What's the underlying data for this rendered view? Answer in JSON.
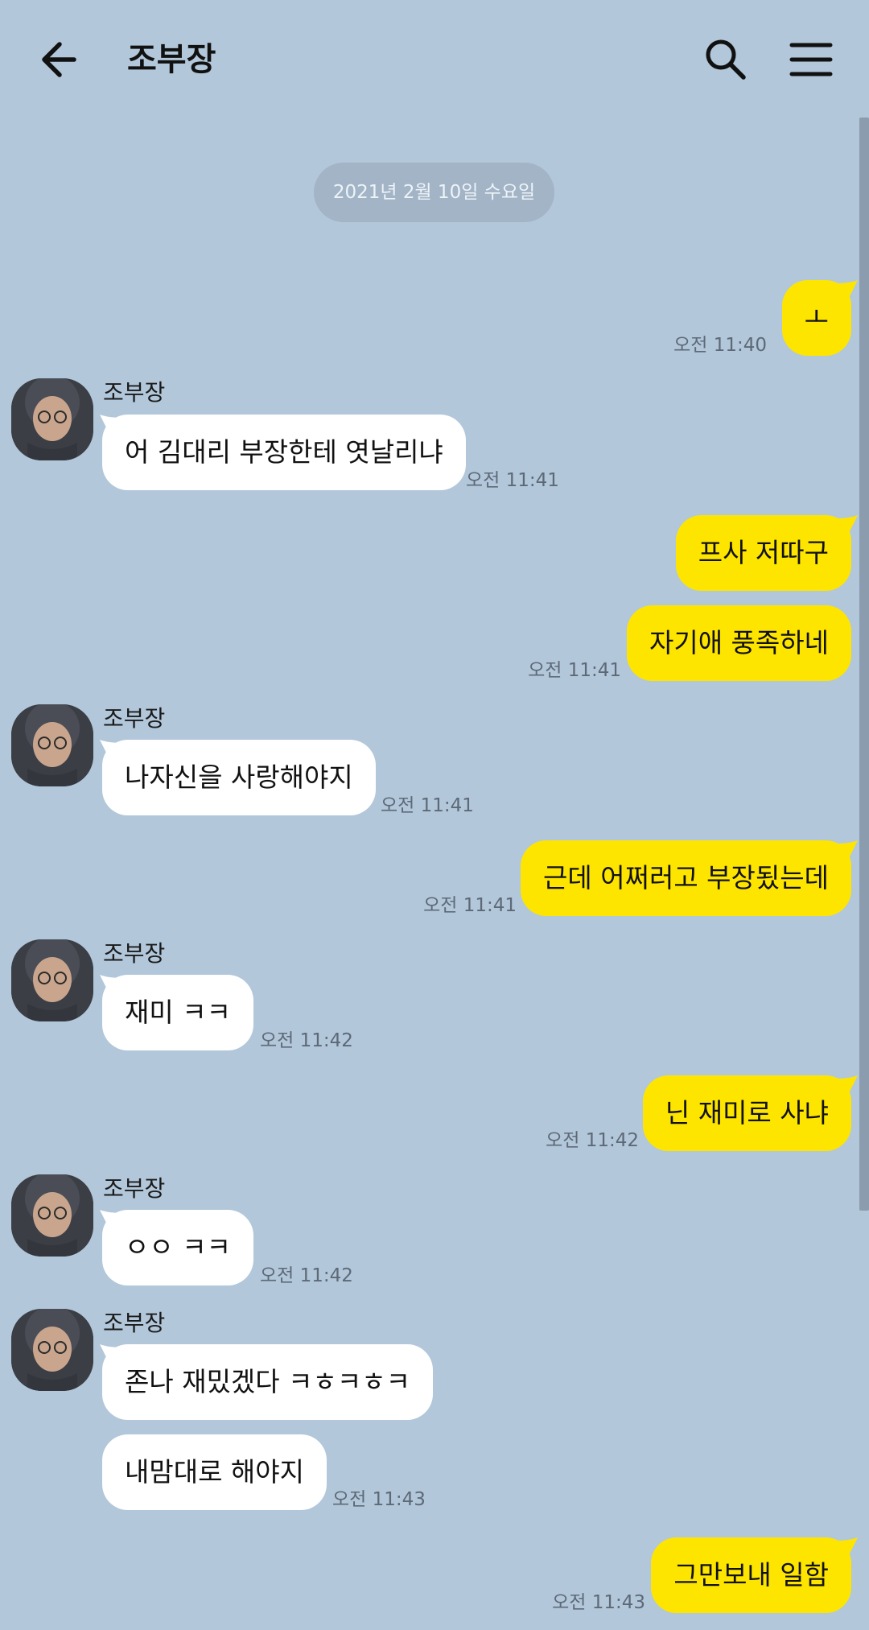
{
  "header": {
    "title": "조부장",
    "back_icon": "arrow-left-icon",
    "search_icon": "search-icon",
    "menu_icon": "hamburger-menu-icon"
  },
  "date_divider": "2021년 2월 10일 수요일",
  "colors": {
    "background": "#b2c7da",
    "outgoing_bubble": "#fee500",
    "incoming_bubble": "#ffffff"
  },
  "messages": [
    {
      "dir": "out",
      "text": "ㅗ",
      "time": "오전 11:40"
    },
    {
      "dir": "in",
      "sender": "조부장",
      "text": "어 김대리 부장한테 엿날리냐",
      "time": "오전 11:41"
    },
    {
      "dir": "out",
      "text": "프사 저따구"
    },
    {
      "dir": "out",
      "text": "자기애 풍족하네",
      "time": "오전 11:41"
    },
    {
      "dir": "in",
      "sender": "조부장",
      "text": "나자신을 사랑해야지",
      "time": "오전 11:41"
    },
    {
      "dir": "out",
      "text": "근데 어쩌러고 부장됬는데",
      "time": "오전 11:41"
    },
    {
      "dir": "in",
      "sender": "조부장",
      "text": "재미 ㅋㅋ",
      "time": "오전 11:42"
    },
    {
      "dir": "out",
      "text": "닌 재미로 사냐",
      "time": "오전 11:42"
    },
    {
      "dir": "in",
      "sender": "조부장",
      "text": "ㅇㅇ ㅋㅋ",
      "time": "오전 11:42"
    },
    {
      "dir": "in",
      "sender": "조부장",
      "text": "존나 재밌겠다 ㅋㅎㅋㅎㅋ"
    },
    {
      "dir": "in",
      "text": "내맘대로 해야지",
      "time": "오전 11:43"
    },
    {
      "dir": "out",
      "text": "그만보내 일함",
      "time": "오전 11:43"
    }
  ]
}
